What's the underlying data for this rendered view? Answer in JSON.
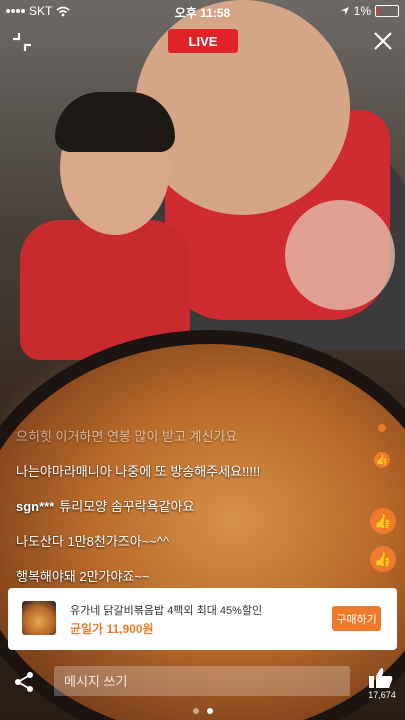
{
  "status_bar": {
    "carrier": "SKT",
    "time": "오후 11:58",
    "battery": "1%"
  },
  "header": {
    "live_label": "LIVE"
  },
  "comments": [
    {
      "user": "",
      "text": "으히힛 이거하면 연봉 많이 받고 계신가요",
      "faded": true
    },
    {
      "user": "",
      "text": "나는야마라매니아 나중에 또 방송해주세요!!!!!"
    },
    {
      "user": "sgn***",
      "text": "튜리모양 솜꾸락욕같아요"
    },
    {
      "user": "",
      "text": "나도산다 1만8천가즈아~~^^"
    },
    {
      "user": "",
      "text": "행복해야돼 2만가야죠~~"
    }
  ],
  "product": {
    "title": "유가네 닭갈비볶음밥 4팩외 최대 45%할인",
    "price": "균일가 11,900원",
    "buy_label": "구매하기"
  },
  "bottom": {
    "message_placeholder": "메시지 쓰기",
    "like_count": "17,674"
  },
  "colors": {
    "accent": "#f07a2c",
    "live": "#e1242a"
  }
}
